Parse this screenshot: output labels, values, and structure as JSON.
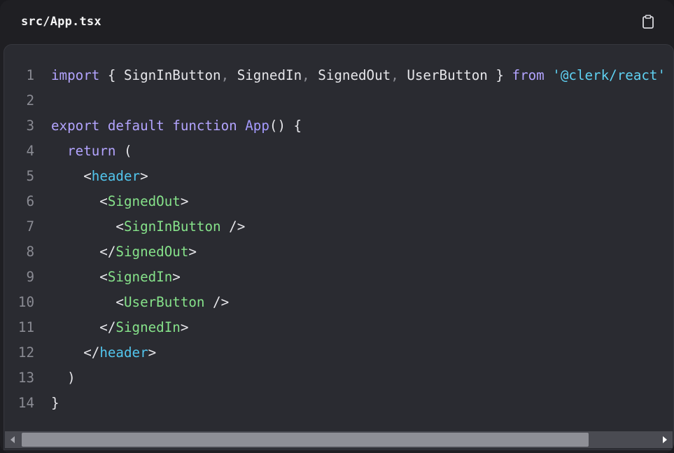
{
  "header": {
    "filename": "src/App.tsx",
    "copy_icon": "clipboard-icon"
  },
  "code": {
    "lines": [
      {
        "n": "1",
        "tokens": [
          [
            "kw",
            "import"
          ],
          [
            "punc",
            " { SignInButton"
          ],
          [
            "dim",
            ","
          ],
          [
            "punc",
            " SignedIn"
          ],
          [
            "dim",
            ","
          ],
          [
            "punc",
            " SignedOut"
          ],
          [
            "dim",
            ","
          ],
          [
            "punc",
            " UserButton } "
          ],
          [
            "kw",
            "from"
          ],
          [
            "punc",
            " "
          ],
          [
            "str",
            "'@clerk/react'"
          ]
        ]
      },
      {
        "n": "2",
        "tokens": []
      },
      {
        "n": "3",
        "tokens": [
          [
            "kw",
            "export default function "
          ],
          [
            "fn",
            "App"
          ],
          [
            "punc",
            "() {"
          ]
        ]
      },
      {
        "n": "4",
        "tokens": [
          [
            "punc",
            "  "
          ],
          [
            "kw",
            "return"
          ],
          [
            "punc",
            " ("
          ]
        ]
      },
      {
        "n": "5",
        "tokens": [
          [
            "punc",
            "    <"
          ],
          [
            "tag",
            "header"
          ],
          [
            "punc",
            ">"
          ]
        ]
      },
      {
        "n": "6",
        "tokens": [
          [
            "punc",
            "      <"
          ],
          [
            "comp",
            "SignedOut"
          ],
          [
            "punc",
            ">"
          ]
        ]
      },
      {
        "n": "7",
        "tokens": [
          [
            "punc",
            "        <"
          ],
          [
            "comp",
            "SignInButton"
          ],
          [
            "punc",
            " />"
          ]
        ]
      },
      {
        "n": "8",
        "tokens": [
          [
            "punc",
            "      </"
          ],
          [
            "comp",
            "SignedOut"
          ],
          [
            "punc",
            ">"
          ]
        ]
      },
      {
        "n": "9",
        "tokens": [
          [
            "punc",
            "      <"
          ],
          [
            "comp",
            "SignedIn"
          ],
          [
            "punc",
            ">"
          ]
        ]
      },
      {
        "n": "10",
        "tokens": [
          [
            "punc",
            "        <"
          ],
          [
            "comp",
            "UserButton"
          ],
          [
            "punc",
            " />"
          ]
        ]
      },
      {
        "n": "11",
        "tokens": [
          [
            "punc",
            "      </"
          ],
          [
            "comp",
            "SignedIn"
          ],
          [
            "punc",
            ">"
          ]
        ]
      },
      {
        "n": "12",
        "tokens": [
          [
            "punc",
            "    </"
          ],
          [
            "tag",
            "header"
          ],
          [
            "punc",
            ">"
          ]
        ]
      },
      {
        "n": "13",
        "tokens": [
          [
            "punc",
            "  )"
          ]
        ]
      },
      {
        "n": "14",
        "tokens": [
          [
            "punc",
            "}"
          ]
        ]
      }
    ]
  },
  "scrollbar": {
    "left_icon": "scroll-left-arrow-icon",
    "right_icon": "scroll-right-arrow-icon",
    "thumb_fraction": 0.87
  },
  "colors": {
    "keyword": "#b3a4ff",
    "string": "#5fd1f2",
    "tag": "#52c6ee",
    "component": "#86e28a",
    "text": "#e6e6ea",
    "line_number": "#8a8b93",
    "panel_bg": "#2a2b31"
  }
}
